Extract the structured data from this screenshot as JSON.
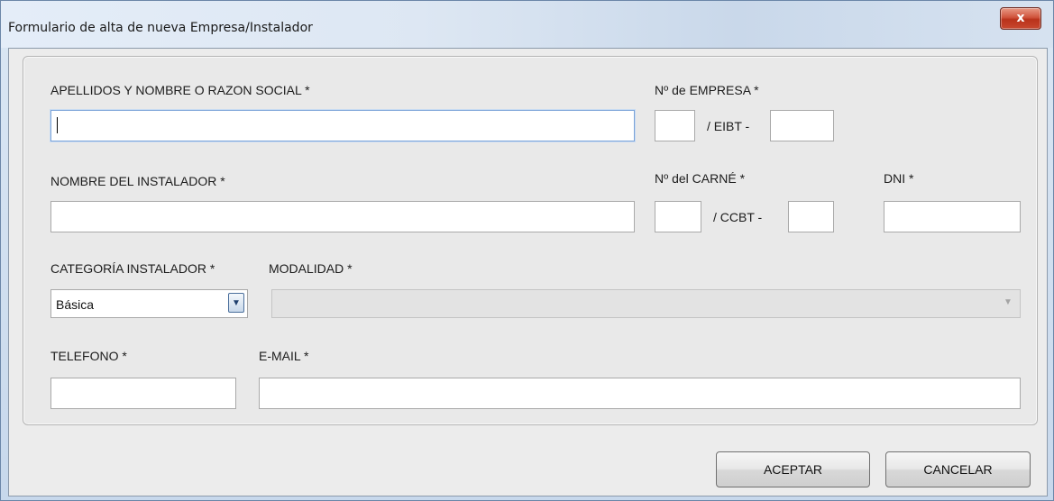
{
  "window": {
    "title": "Formulario de alta de nueva Empresa/Instalador",
    "close_label": "x"
  },
  "form": {
    "razon_social": {
      "label": "APELLIDOS Y NOMBRE O RAZON SOCIAL *",
      "value": ""
    },
    "num_empresa": {
      "label": "Nº de EMPRESA *",
      "separator": "/ EIBT -",
      "part1": "",
      "part2": ""
    },
    "instalador": {
      "label": "NOMBRE DEL INSTALADOR *",
      "value": ""
    },
    "num_carne": {
      "label": "Nº del CARNÉ *",
      "separator": "/ CCBT -",
      "part1": "",
      "part2": ""
    },
    "dni": {
      "label": "DNI *",
      "value": ""
    },
    "categoria": {
      "label": "CATEGORÍA INSTALADOR *",
      "value": "Básica",
      "arrow_icon": "▼"
    },
    "modalidad": {
      "label": "MODALIDAD *",
      "value": "",
      "arrow_icon": "▼",
      "enabled": false
    },
    "telefono": {
      "label": "TELEFONO *",
      "value": ""
    },
    "email": {
      "label": "E-MAIL *",
      "value": ""
    }
  },
  "buttons": {
    "accept": "ACEPTAR",
    "cancel": "CANCELAR"
  }
}
